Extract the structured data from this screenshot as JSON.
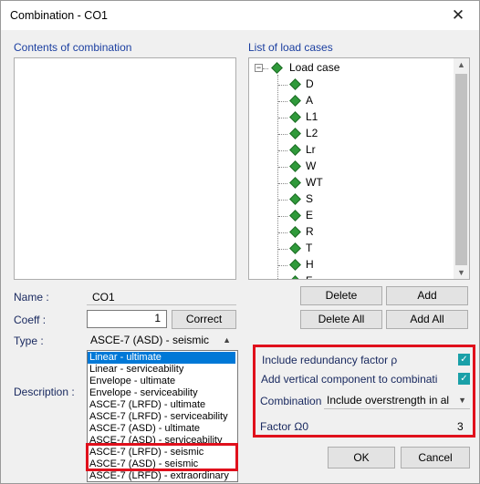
{
  "window": {
    "title": "Combination - CO1",
    "close_glyph": "✕"
  },
  "contents": {
    "label": "Contents of combination"
  },
  "loadcases": {
    "label": "List of load cases",
    "root": "Load case",
    "items": [
      "D",
      "A",
      "L1",
      "L2",
      "Lr",
      "W",
      "WT",
      "S",
      "E",
      "R",
      "T",
      "H",
      "F"
    ]
  },
  "buttons": {
    "delete": "Delete",
    "add": "Add",
    "delete_all": "Delete All",
    "add_all": "Add All",
    "correct": "Correct",
    "ok": "OK",
    "cancel": "Cancel"
  },
  "form": {
    "name_label": "Name :",
    "name_value": "CO1",
    "coeff_label": "Coeff :",
    "coeff_value": "1",
    "type_label": "Type :",
    "type_value": "ASCE-7 (ASD) - seismic",
    "description_label": "Description :"
  },
  "type_options": [
    "Linear - ultimate",
    "Linear - serviceability",
    "Envelope - ultimate",
    "Envelope - serviceability",
    "ASCE-7 (LRFD) - ultimate",
    "ASCE-7 (LRFD) - serviceability",
    "ASCE-7 (ASD) - ultimate",
    "ASCE-7 (ASD) - serviceability",
    "ASCE-7 (LRFD) - seismic",
    "ASCE-7 (ASD) - seismic",
    "ASCE-7 (LRFD) - extraordinary"
  ],
  "type_selected_index": 0,
  "seismic": {
    "redundancy_label": "Include redundancy factor ρ",
    "redundancy_checked": true,
    "vertical_label": "Add vertical component to combinati",
    "vertical_checked": true,
    "combination_label": "Combination",
    "combination_value": "Include overstrength in al",
    "factor_label": "Factor Ω0",
    "factor_value": "3"
  },
  "colors": {
    "highlight_red": "#e0101c",
    "accent_blue": "#0078d7",
    "check_teal": "#1aa0a8",
    "diamond_green": "#2f9a3a"
  }
}
